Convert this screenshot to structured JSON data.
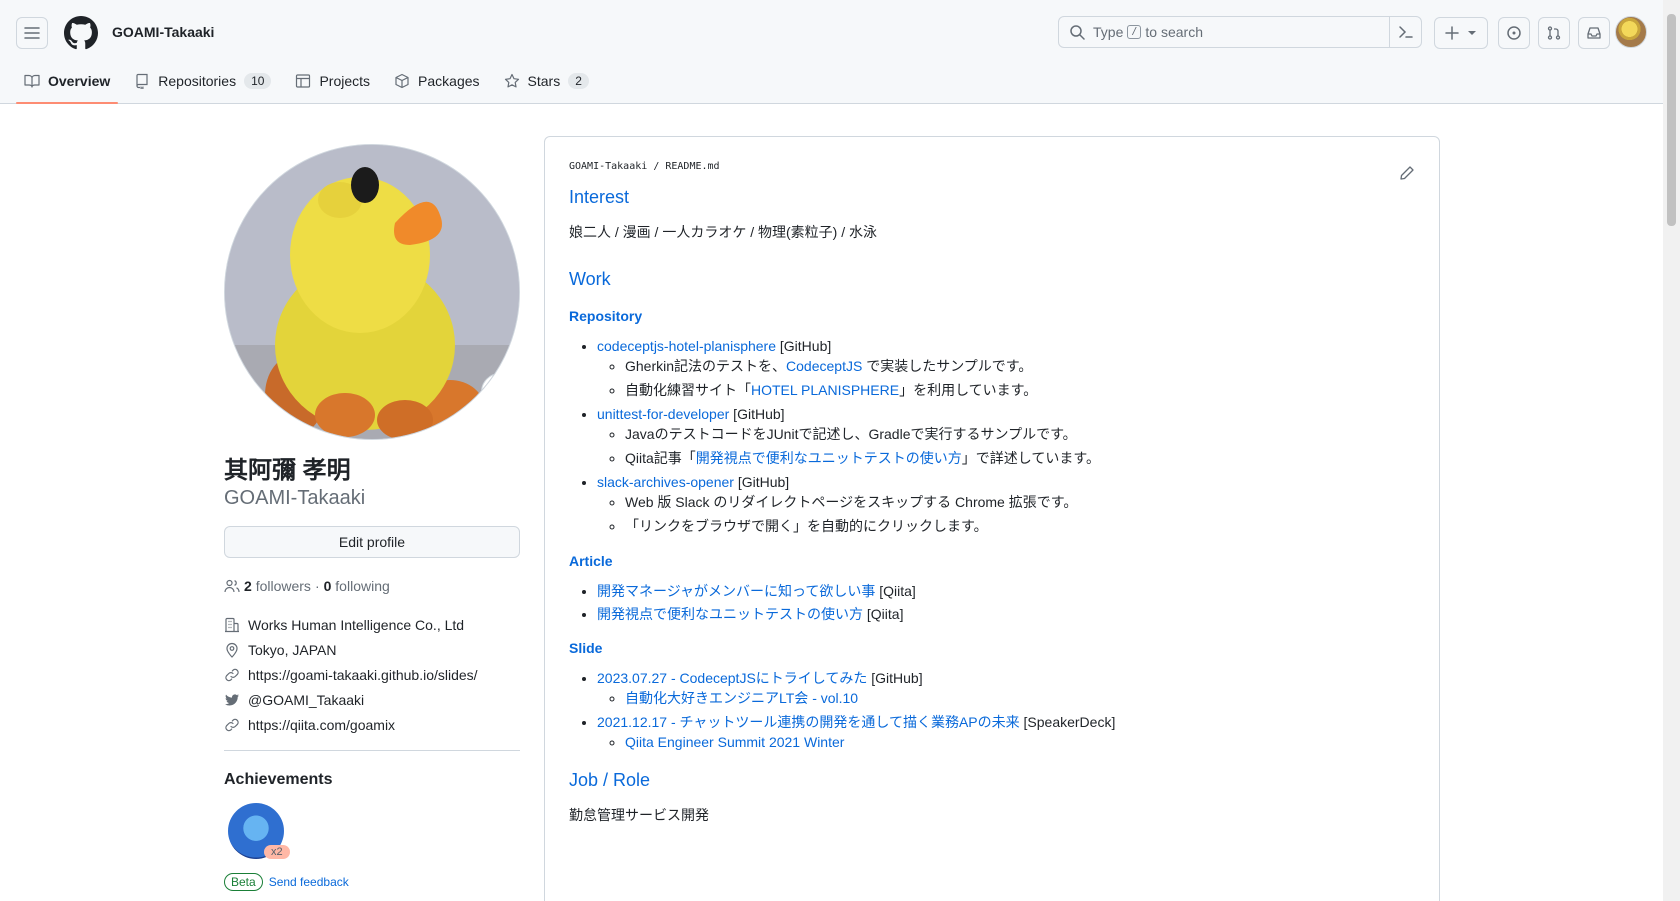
{
  "header": {
    "username": "GOAMI-Takaaki",
    "search_prefix": "Type",
    "search_key": "/",
    "search_suffix": "to search"
  },
  "tabs": [
    {
      "label": "Overview",
      "count": null
    },
    {
      "label": "Repositories",
      "count": "10"
    },
    {
      "label": "Projects",
      "count": null
    },
    {
      "label": "Packages",
      "count": null
    },
    {
      "label": "Stars",
      "count": "2"
    }
  ],
  "profile": {
    "fullname": "其阿彌 孝明",
    "login": "GOAMI-Takaaki",
    "edit_label": "Edit profile",
    "followers_count": "2",
    "followers_label": "followers",
    "sep": "·",
    "following_count": "0",
    "following_label": "following",
    "company": "Works Human Intelligence Co., Ltd",
    "location": "Tokyo, JAPAN",
    "website": "https://goami-takaaki.github.io/slides/",
    "twitter": "@GOAMI_Takaaki",
    "qiita": "https://qiita.com/goamix",
    "achievements_title": "Achievements",
    "badge_count": "x2",
    "beta": "Beta",
    "feedback": "Send feedback"
  },
  "readme": {
    "path_user": "GOAMI-Takaaki",
    "path_sep": "/",
    "path_file": "README.md",
    "interest_title": "Interest",
    "interest_text": "娘二人 / 漫画 / 一人カラオケ / 物理(素粒子) / 水泳",
    "work_title": "Work",
    "repository_title": "Repository",
    "repo1_link": "codeceptjs-hotel-planisphere",
    "repo1_tag": " [GitHub]",
    "repo1_sub1_a": "Gherkin記法のテストを、",
    "repo1_sub1_link": "CodeceptJS",
    "repo1_sub1_b": " で実装したサンプルです。",
    "repo1_sub2_a": "自動化練習サイト「",
    "repo1_sub2_link": "HOTEL PLANISPHERE",
    "repo1_sub2_b": "」を利用しています。",
    "repo2_link": "unittest-for-developer",
    "repo2_tag": " [GitHub]",
    "repo2_sub1": "JavaのテストコードをJUnitで記述し、Gradleで実行するサンプルです。",
    "repo2_sub2_a": "Qiita記事「",
    "repo2_sub2_link": "開発視点で便利なユニットテストの使い方",
    "repo2_sub2_b": "」で詳述しています。",
    "repo3_link": "slack-archives-opener",
    "repo3_tag": " [GitHub]",
    "repo3_sub1": "Web 版 Slack のリダイレクトページをスキップする Chrome 拡張です。",
    "repo3_sub2": "「リンクをブラウザで開く」を自動的にクリックします。",
    "article_title": "Article",
    "article1_link": "開発マネージャがメンバーに知って欲しい事",
    "article1_tag": " [Qiita]",
    "article2_link": "開発視点で便利なユニットテストの使い方",
    "article2_tag": " [Qiita]",
    "slide_title": "Slide",
    "slide1_link": "2023.07.27 - CodeceptJSにトライしてみた",
    "slide1_tag": " [GitHub]",
    "slide1_sub": "自動化大好きエンジニアLT会 - vol.10",
    "slide2_link": "2021.12.17 - チャットツール連携の開発を通して描く業務APの未来",
    "slide2_tag": " [SpeakerDeck]",
    "slide2_sub": "Qiita Engineer Summit 2021 Winter",
    "job_title": "Job / Role",
    "job_text": "勤怠管理サービス開発"
  }
}
